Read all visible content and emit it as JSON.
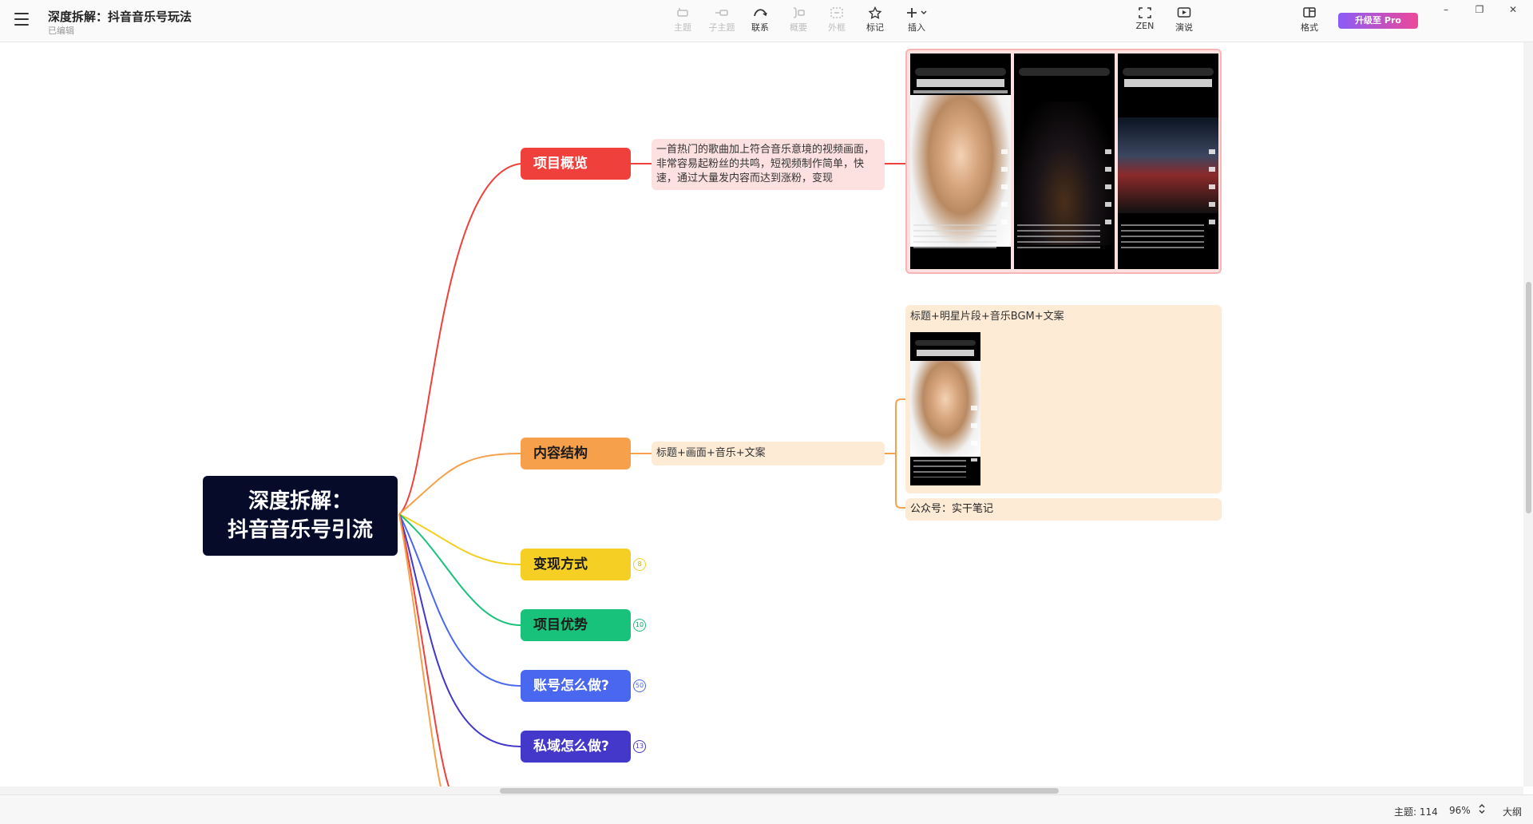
{
  "header": {
    "title": "深度拆解：抖音音乐号玩法",
    "status": "已编辑",
    "tools": [
      {
        "label": "主题",
        "icon": "topic-icon",
        "enabled": false
      },
      {
        "label": "子主题",
        "icon": "subtopic-icon",
        "enabled": false
      },
      {
        "label": "联系",
        "icon": "relationship-icon",
        "enabled": true
      },
      {
        "label": "概要",
        "icon": "summary-icon",
        "enabled": false
      },
      {
        "label": "外框",
        "icon": "boundary-icon",
        "enabled": false
      },
      {
        "label": "标记",
        "icon": "star-icon",
        "enabled": true
      },
      {
        "label": "插入",
        "icon": "plus-icon",
        "enabled": true
      }
    ],
    "right_tools": [
      {
        "label": "ZEN",
        "icon": "fullscreen-icon"
      },
      {
        "label": "演说",
        "icon": "pitch-icon"
      },
      {
        "label": "格式",
        "icon": "format-panel-icon"
      }
    ],
    "pro_label": "升级至 Pro",
    "window_controls": [
      "–",
      "❐",
      "✕"
    ]
  },
  "mindmap": {
    "root": {
      "line1": "深度拆解：",
      "line2": "抖音音乐号引流"
    },
    "branches": [
      {
        "label": "项目概览",
        "color": "#f0403c",
        "text_color": "#ffffff",
        "badge": ""
      },
      {
        "label": "内容结构",
        "color": "#f7a04b",
        "text_color": "#1b1b1b",
        "badge": ""
      },
      {
        "label": "变现方式",
        "color": "#f5cf24",
        "text_color": "#1b1b1b",
        "badge": "8"
      },
      {
        "label": "项目优势",
        "color": "#18c27a",
        "text_color": "#1b1b1b",
        "badge": "10"
      },
      {
        "label": "账号怎么做?",
        "color": "#4a67f0",
        "text_color": "#ffffff",
        "badge": "50"
      },
      {
        "label": "私域怎么做?",
        "color": "#4338ca",
        "text_color": "#ffffff",
        "badge": "13"
      }
    ],
    "overview_note": "一首热门的歌曲加上符合音乐意境的视频画面，非常容易起粉丝的共鸣，短视频制作简单，快速，通过大量发内容而达到涨粉，变现",
    "structure_note": "标题+画面+音乐+文案",
    "structure_detail_title": "标题+明星片段+音乐BGM+文案",
    "structure_footer": "公众号：实干笔记",
    "phones": [
      "portrait",
      "night-road",
      "concert"
    ]
  },
  "status": {
    "topics": "主题: 114",
    "zoom": "96%",
    "outline": "大纲"
  }
}
